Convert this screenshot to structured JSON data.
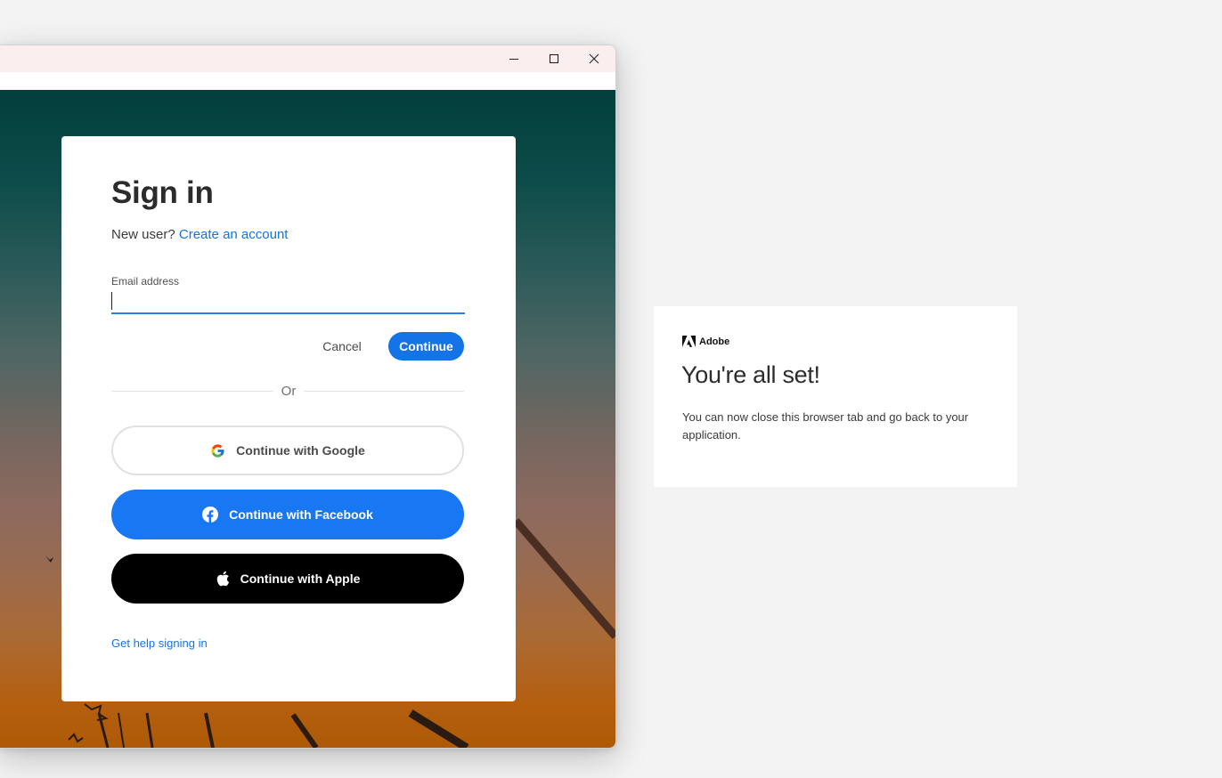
{
  "window": {
    "controls": {
      "minimize": "minimize-icon",
      "maximize": "maximize-icon",
      "close": "close-icon"
    }
  },
  "signin": {
    "title": "Sign in",
    "new_user_prefix": "New user?",
    "create_account": "Create an account",
    "email_label": "Email address",
    "email_value": "",
    "cancel_label": "Cancel",
    "continue_label": "Continue",
    "or_label": "Or",
    "google_label": "Continue with Google",
    "facebook_label": "Continue with Facebook",
    "apple_label": "Continue with Apple",
    "help_label": "Get help signing in"
  },
  "confirmation": {
    "brand": "Adobe",
    "title": "You're all set!",
    "message": "You can now close this browser tab and go back to your application."
  },
  "colors": {
    "accent": "#1473e6",
    "facebook": "#1877f2",
    "apple": "#000000",
    "card": "#ffffff",
    "page_background": "#f3f3f3"
  }
}
